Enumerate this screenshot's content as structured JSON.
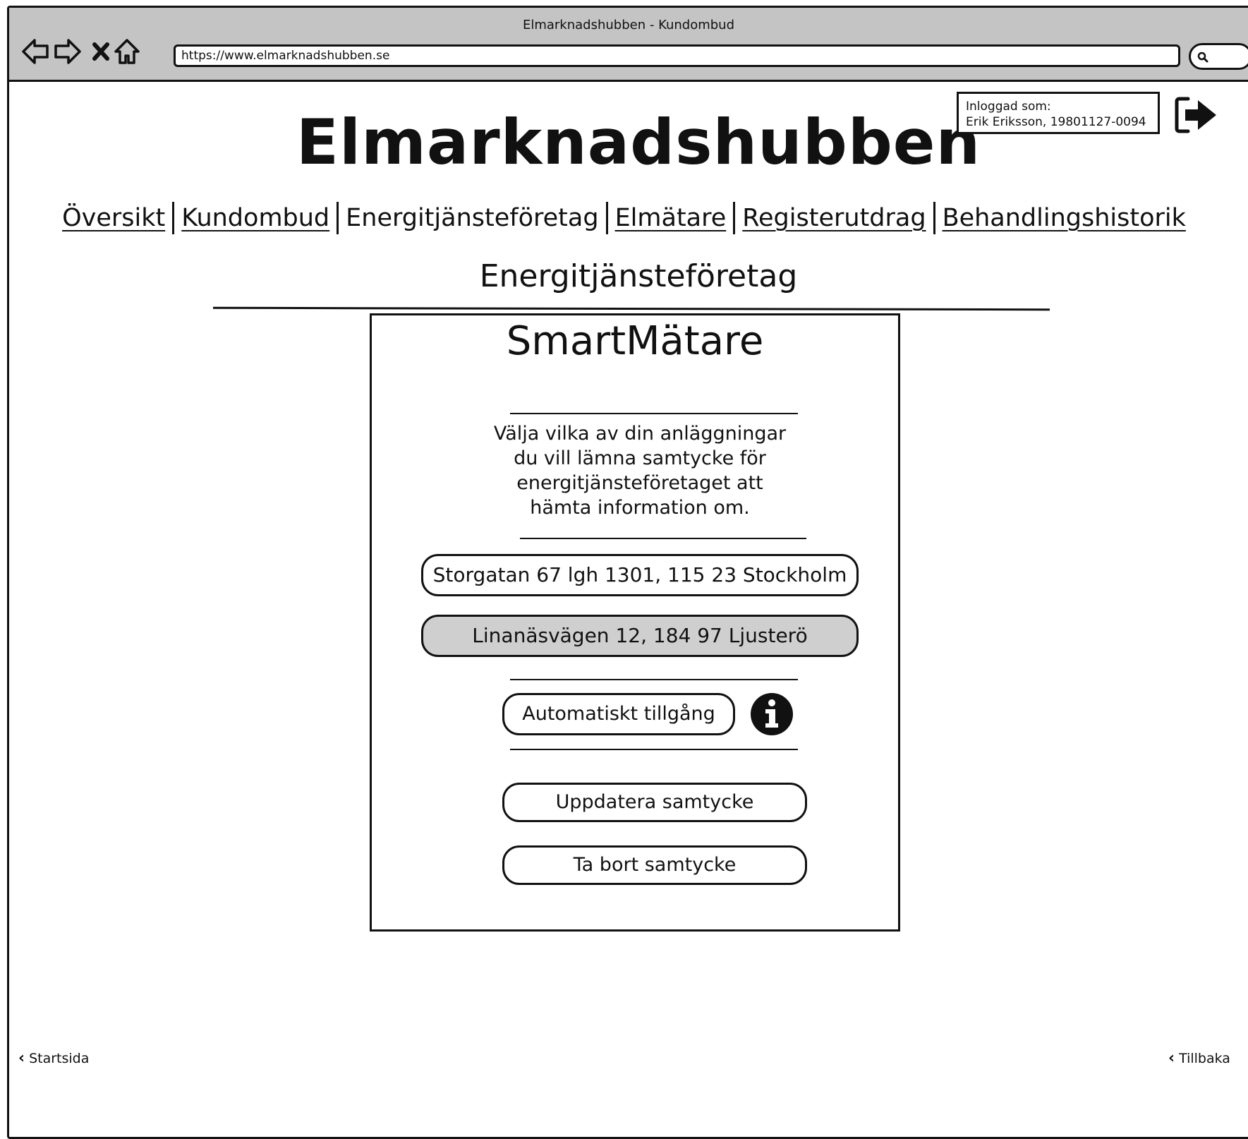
{
  "window": {
    "title": "Elmarknadshubben - Kundombud",
    "url": "https://www.elmarknadshubben.se"
  },
  "header": {
    "brand": "Elmarknadshubben",
    "user_label": "Inloggad som:",
    "user_value": "Erik Eriksson, 19801127-0094"
  },
  "nav": {
    "items": [
      {
        "label": "Översikt"
      },
      {
        "label": "Kundombud"
      },
      {
        "label": "Energitjänsteföretag"
      },
      {
        "label": "Elmätare"
      },
      {
        "label": "Registerutdrag"
      },
      {
        "label": "Behandlingshistorik"
      }
    ],
    "active": "Energitjänsteföretag"
  },
  "page": {
    "section_title": "Energitjänsteföretag"
  },
  "panel": {
    "title": "SmartMätare",
    "description": "Välja vilka av din anläggningar du vill lämna samtycke för energitjänsteföretaget att hämta information om.",
    "facilities": [
      {
        "label": "Storgatan 67 lgh 1301, 115 23 Stockholm",
        "selected": false
      },
      {
        "label": "Linanäsvägen 12, 184 97 Ljusterö",
        "selected": true
      }
    ],
    "auto_access_label": "Automatiskt tillgång",
    "update_label": "Uppdatera samtycke",
    "remove_label": "Ta bort samtycke"
  },
  "footer": {
    "left_label": "Startsida",
    "right_label": "Tillbaka"
  },
  "icons": [
    "back-arrow-icon",
    "forward-arrow-icon",
    "close-icon",
    "home-icon",
    "search-icon",
    "logout-icon",
    "info-icon",
    "chevron-left-icon"
  ],
  "colors": {
    "chrome": "#c4c4c4",
    "selected_fill": "#cfcfcf",
    "ink": "#111111"
  }
}
